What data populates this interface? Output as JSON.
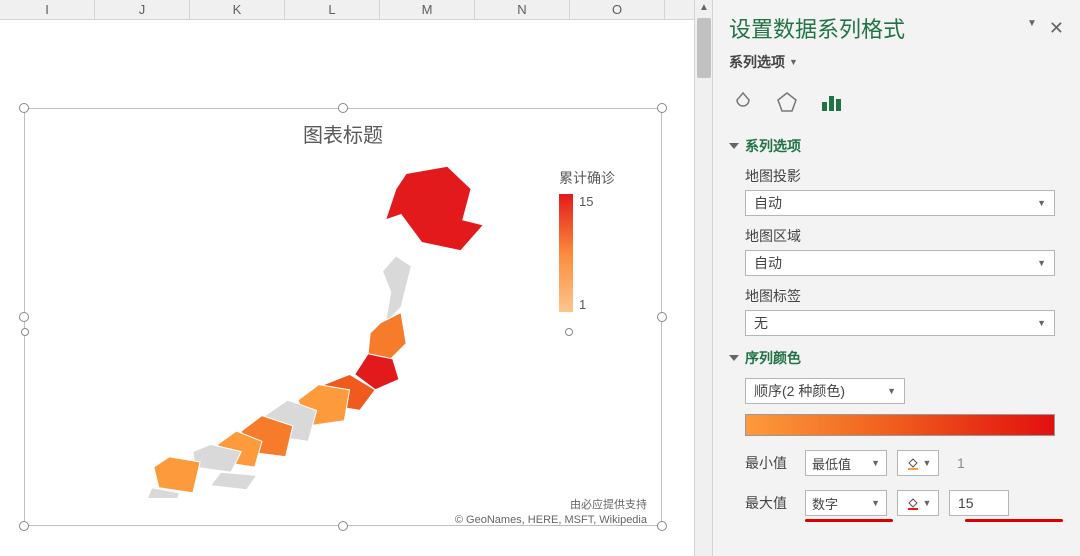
{
  "columns": [
    "I",
    "J",
    "K",
    "L",
    "M",
    "N",
    "O"
  ],
  "chart": {
    "title": "图表标题",
    "legend_title": "累计确诊",
    "legend_max": "15",
    "legend_min": "1",
    "attrib_line1": "由必应提供支持",
    "attrib_line2": "© GeoNames, HERE, MSFT, Wikipedia"
  },
  "panel": {
    "title": "设置数据系列格式",
    "series_dropdown": "系列选项",
    "section_series": "系列选项",
    "map_projection_label": "地图投影",
    "map_projection_value": "自动",
    "map_area_label": "地图区域",
    "map_area_value": "自动",
    "map_labels_label": "地图标签",
    "map_labels_value": "无",
    "section_colors": "序列颜色",
    "color_scheme": "顺序(2 种颜色)",
    "min_label": "最小值",
    "min_select": "最低值",
    "min_value": "1",
    "max_label": "最大值",
    "max_select": "数字",
    "max_value": "15"
  },
  "chart_data": {
    "type": "heatmap",
    "title": "图表标题",
    "legend_title": "累计确诊",
    "value_range": [
      1,
      15
    ],
    "color_min": "#fdc58c",
    "color_max": "#e31a1c",
    "note": "Choropleth map of Japan prefectures colored by confirmed cases; individual prefecture values not labeled in image, range 1-15"
  }
}
